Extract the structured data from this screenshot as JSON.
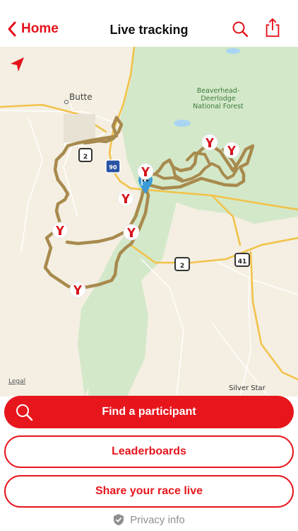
{
  "navbar": {
    "back_label": "Home",
    "title": "Live tracking",
    "icons": [
      "chevron-left-icon",
      "search-icon",
      "share-icon"
    ]
  },
  "map": {
    "labels": {
      "city": "Butte",
      "forest": "Beaverhead-Deerlodge National Forest",
      "forest_line1": "Beaverhead-",
      "forest_line2": "Deerlodge",
      "forest_line3": "National Forest",
      "legal": "Legal",
      "town": "Silver Star"
    },
    "shields": [
      "2",
      "90",
      "2",
      "41"
    ],
    "icons": [
      "location-arrow-icon",
      "finish-flag-icon",
      "participant-marker-icon"
    ],
    "colors": {
      "route": "#a88a4e",
      "forest": "#d3e8c9",
      "marker": "#d7141c",
      "flag": "#3c9bd6",
      "road": "#f2c24a"
    }
  },
  "actions": {
    "find_participant": "Find a participant",
    "leaderboards": "Leaderboards",
    "share_race": "Share your race live"
  },
  "footer": {
    "privacy": "Privacy info"
  },
  "colors": {
    "accent": "#e7161d"
  }
}
